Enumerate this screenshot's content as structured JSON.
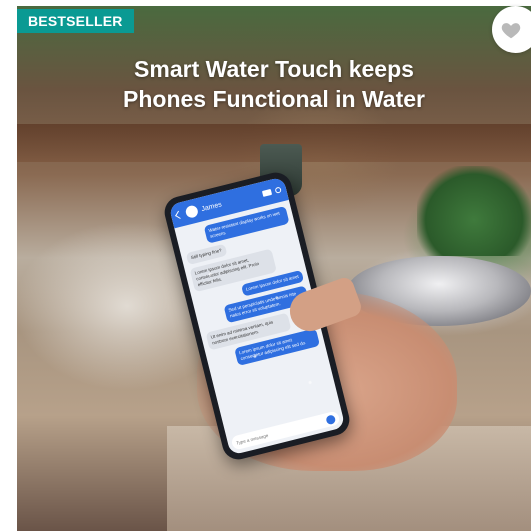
{
  "badge": {
    "label": "BESTSELLER",
    "color": "#0a9a93"
  },
  "headline": {
    "line1": "Smart Water Touch keeps",
    "line2": "Phones Functional in Water"
  },
  "wishlist": {
    "icon": "heart-icon"
  },
  "phone_screen": {
    "contact_name": "James",
    "messages": [
      {
        "direction": "out",
        "text": "Water-resistant display works on wet screens"
      },
      {
        "direction": "in",
        "text": "Still typing fine?"
      },
      {
        "direction": "in",
        "text": "Lorem ipsum dolor sit amet, consectetur adipiscing elit. Proin efficitur felis."
      },
      {
        "direction": "out",
        "text": "Lorem ipsum dolor sit amet"
      },
      {
        "direction": "out",
        "text": "Sed ut perspiciatis unde omnis iste natus error sit voluptatem."
      },
      {
        "direction": "in",
        "text": "Ut enim ad minima veniam, quis nostrum exercitationem."
      },
      {
        "direction": "out",
        "text": "Lorem ipsum dolor sit amet consectetur adipiscing elit sed do."
      }
    ],
    "composer_placeholder": "Type a message"
  }
}
